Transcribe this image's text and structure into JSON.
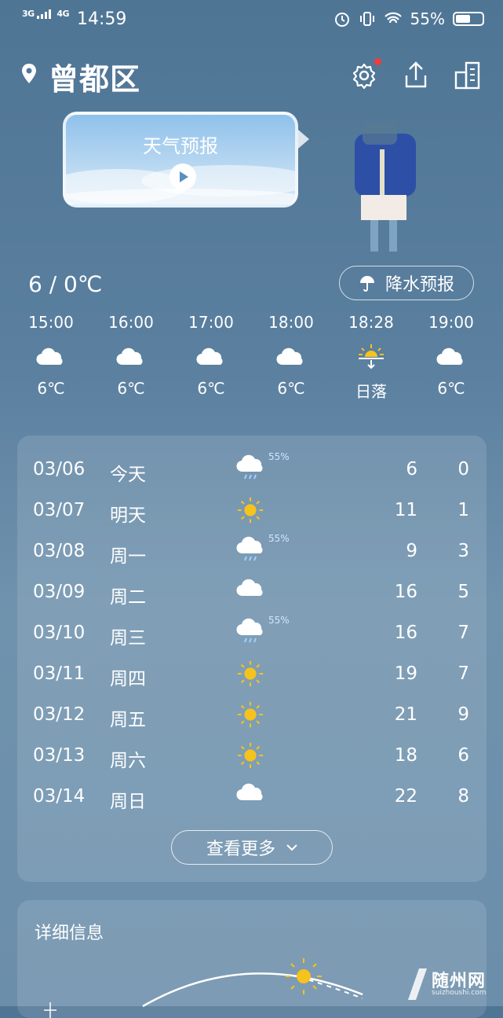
{
  "status": {
    "network_1": "3G",
    "network_2": "4G",
    "time": "14:59",
    "battery": "55%",
    "battery_level": 0.55
  },
  "header": {
    "city": "曾都区"
  },
  "video": {
    "title": "天气预报"
  },
  "current": {
    "temp_range": "6 / 0℃",
    "precip_button": "降水预报"
  },
  "hourly": [
    {
      "time": "15:00",
      "icon": "cloud-icon",
      "value": "6℃"
    },
    {
      "time": "16:00",
      "icon": "cloud-icon",
      "value": "6℃"
    },
    {
      "time": "17:00",
      "icon": "cloud-icon",
      "value": "6℃"
    },
    {
      "time": "18:00",
      "icon": "cloud-icon",
      "value": "6℃"
    },
    {
      "time": "18:28",
      "icon": "sunset-icon",
      "value": "日落"
    },
    {
      "time": "19:00",
      "icon": "cloud-icon",
      "value": "6℃"
    }
  ],
  "daily": [
    {
      "date": "03/06",
      "day": "今天",
      "icon": "rain-cloud-icon",
      "pct": "55%",
      "hi": "6",
      "lo": "0"
    },
    {
      "date": "03/07",
      "day": "明天",
      "icon": "sun-icon",
      "pct": "",
      "hi": "11",
      "lo": "1"
    },
    {
      "date": "03/08",
      "day": "周一",
      "icon": "rain-cloud-icon",
      "pct": "55%",
      "hi": "9",
      "lo": "3"
    },
    {
      "date": "03/09",
      "day": "周二",
      "icon": "cloud-icon",
      "pct": "",
      "hi": "16",
      "lo": "5"
    },
    {
      "date": "03/10",
      "day": "周三",
      "icon": "rain-cloud-icon",
      "pct": "55%",
      "hi": "16",
      "lo": "7"
    },
    {
      "date": "03/11",
      "day": "周四",
      "icon": "sun-icon",
      "pct": "",
      "hi": "19",
      "lo": "7"
    },
    {
      "date": "03/12",
      "day": "周五",
      "icon": "sun-icon",
      "pct": "",
      "hi": "21",
      "lo": "9"
    },
    {
      "date": "03/13",
      "day": "周六",
      "icon": "sun-icon",
      "pct": "",
      "hi": "18",
      "lo": "6"
    },
    {
      "date": "03/14",
      "day": "周日",
      "icon": "cloud-icon",
      "pct": "",
      "hi": "22",
      "lo": "8"
    }
  ],
  "more_button": "查看更多",
  "details": {
    "title": "详细信息"
  },
  "watermark": {
    "brand": "随州网",
    "url": "suizhoushi.com"
  },
  "colors": {
    "sun": "#f6c21c",
    "accent_red": "#f23b3b"
  }
}
